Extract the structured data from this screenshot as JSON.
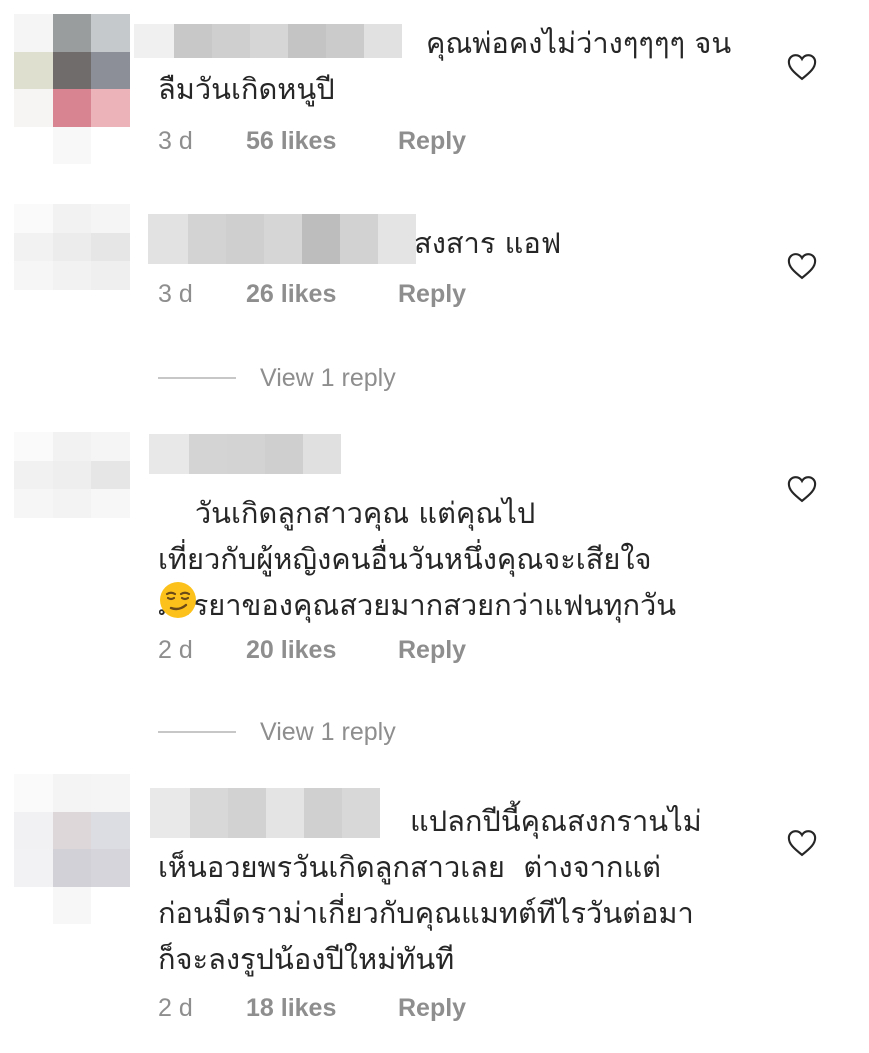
{
  "comments": [
    {
      "text": "คุณพ่อคงไม่ว่างๆๆๆๆ จน\nลืมวันเกิดหนูปี",
      "time": "3 d",
      "likes": "56 likes",
      "reply": "Reply",
      "avatar_colors": [
        "#f5f5f5",
        "#9a9d9d",
        "#c5c9cc",
        "#dfdfd0",
        "#706c6b",
        "#8c8e98",
        "#f7f4f4",
        "#d98591",
        "#ecb4b9",
        "#ffffff",
        "#f8f8f8",
        "#ffffff"
      ],
      "username_colors": [
        "#f0f0f0",
        "#c8c8c8",
        "#cfcfcf",
        "#d6d6d6",
        "#c4c4c4",
        "#cbcbcb",
        "#e1e1e1"
      ]
    },
    {
      "text": "สงสาร แอฟ",
      "time": "3 d",
      "likes": "26 likes",
      "reply": "Reply",
      "avatar_colors": [
        "#fafafa",
        "#f2f2f2",
        "#f5f5f5",
        "#f2f2f2",
        "#ececec",
        "#e6e6e6",
        "#f6f6f6",
        "#f2f2f2",
        "#efefef",
        "#ffffff",
        "#ffffff",
        "#ffffff"
      ],
      "username_colors": [
        "#e2e2e2",
        "#d3d3d3",
        "#cfcfcf",
        "#d6d6d6",
        "#bdbdbd",
        "#d2d2d2",
        "#e4e4e4"
      ]
    },
    {
      "text": "วันเกิดลูกสาวคุณ แต่คุณไป\nเที่ยวกับผู้หญิงคนอื่นวันหนึ่งคุณจะเสียใจ\nภรรยาของคุณสวยมากสวยกว่าแฟนทุกวัน",
      "time": "2 d",
      "likes": "20 likes",
      "reply": "Reply",
      "avatar_colors": [
        "#fafafa",
        "#f2f2f2",
        "#f5f5f5",
        "#f1f1f1",
        "#eeeeee",
        "#e6e6e6",
        "#f6f6f6",
        "#f3f3f3",
        "#f7f7f7",
        "#ffffff",
        "#ffffff",
        "#ffffff"
      ],
      "username_colors": [
        "#e8e8e8",
        "#d4d4d4",
        "#d3d3d3",
        "#cfcfcf",
        "#e0e0e0"
      ]
    },
    {
      "text": "แปลกปีนี้คุณสงกรานไม่\nเห็นอวยพรวันเกิดลูกสาวเลย  ต่างจากแต่\nก่อนมีดราม่าเกี่ยวกับคุณแมทต์ทีไรวันต่อมา\nก็จะลงรูปน้องปีใหม่ทันที",
      "time": "2 d",
      "likes": "18 likes",
      "reply": "Reply",
      "avatar_colors": [
        "#fafafa",
        "#f4f4f4",
        "#f5f5f5",
        "#f1f1f4",
        "#ddd7da",
        "#dcdde2",
        "#f2f2f5",
        "#d3d1d8",
        "#d6d5dc",
        "#ffffff",
        "#f7f7f7",
        "#ffffff"
      ],
      "username_colors": [
        "#e9e9e9",
        "#d8d8d8",
        "#d2d2d2",
        "#e4e4e4",
        "#d0d0d0",
        "#d8d8d8"
      ]
    }
  ],
  "view_replies": [
    {
      "label": "View 1 reply"
    },
    {
      "label": "View 1 reply"
    }
  ],
  "icons": {
    "like": "heart-outline-icon",
    "emoji": "smirking-face-emoji"
  },
  "colors": {
    "text": "#262626",
    "meta": "#8e8e8e",
    "divider": "#c7c7c7"
  }
}
